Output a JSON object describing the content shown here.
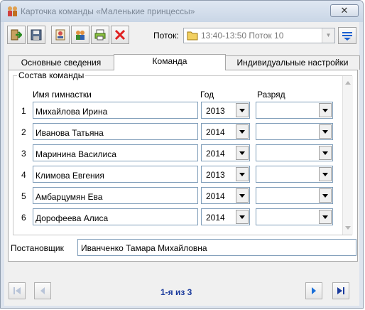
{
  "window": {
    "title": "Карточка команды «Маленькие принцессы»",
    "close_label": "✕"
  },
  "toolbar": {
    "stream_label": "Поток:",
    "stream_value": "13:40-13:50 Поток 10",
    "buttons": [
      "exit-icon",
      "save-icon",
      "card-icon",
      "users-icon",
      "print-icon",
      "delete-icon",
      "filter-icon"
    ]
  },
  "tabs": [
    {
      "label": "Основные сведения",
      "active": false
    },
    {
      "label": "Команда",
      "active": true
    },
    {
      "label": "Индивидуальные настройки",
      "active": false
    }
  ],
  "team": {
    "group_title": "Состав команды",
    "col_name": "Имя гимнастки",
    "col_year": "Год",
    "col_rank": "Разряд",
    "rows": [
      {
        "num": "1",
        "name": "Михайлова Ирина",
        "year": "2013",
        "rank": ""
      },
      {
        "num": "2",
        "name": "Иванова Татьяна",
        "year": "2014",
        "rank": ""
      },
      {
        "num": "3",
        "name": "Маринина Василиса",
        "year": "2014",
        "rank": ""
      },
      {
        "num": "4",
        "name": "Климова Евгения",
        "year": "2013",
        "rank": ""
      },
      {
        "num": "5",
        "name": "Амбарцумян Ева",
        "year": "2014",
        "rank": ""
      },
      {
        "num": "6",
        "name": "Дорофеева Алиса",
        "year": "2014",
        "rank": ""
      }
    ]
  },
  "author": {
    "label": "Постановщик",
    "value": "Иванченко Тамара Михайловна"
  },
  "navigation": {
    "page_text": "1-я из 3"
  },
  "colors": {
    "accent": "#1a3a9c",
    "window_frame": "#c9d6e6"
  }
}
